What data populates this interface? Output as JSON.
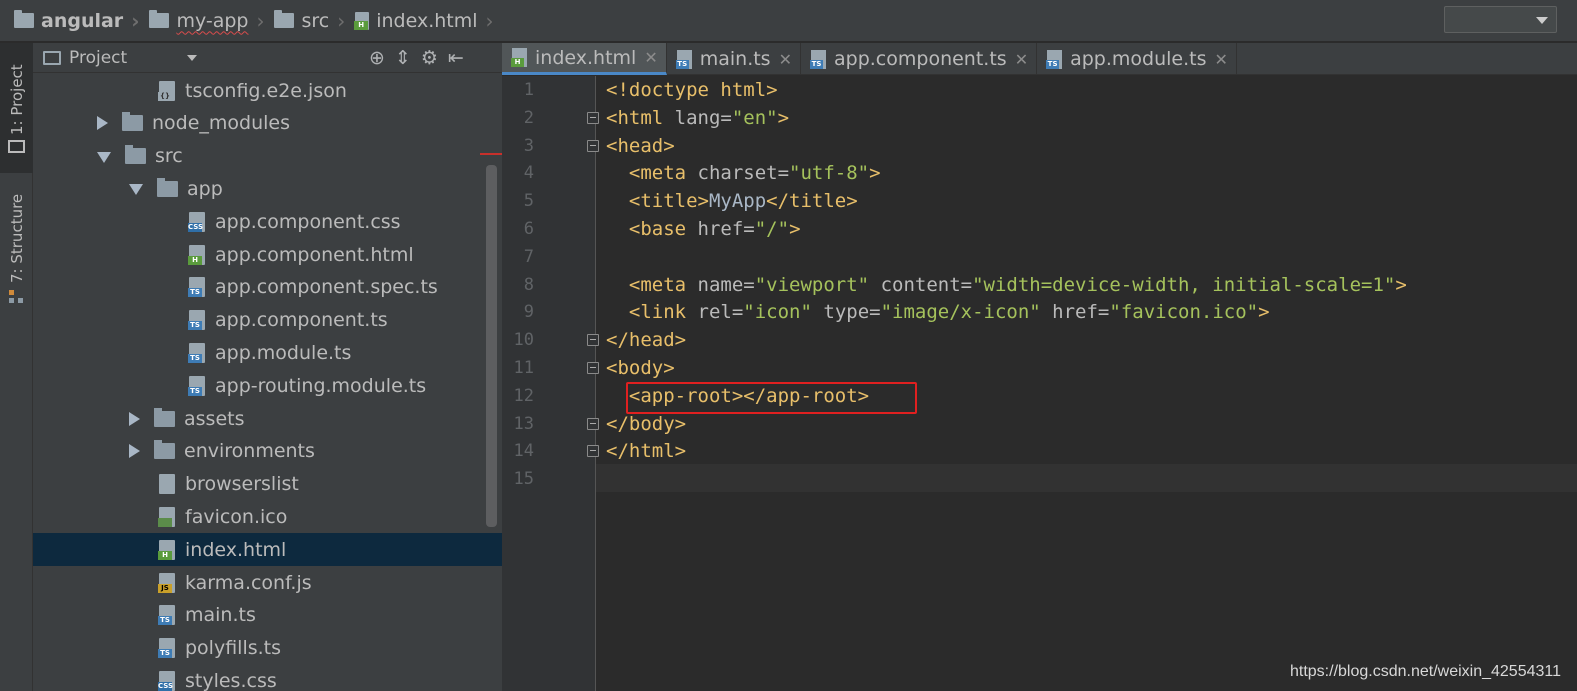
{
  "breadcrumb": [
    {
      "label": "angular",
      "bold": true
    },
    {
      "label": "my-app",
      "squiggle": true
    },
    {
      "label": "src"
    },
    {
      "label": "index.html",
      "file": true
    }
  ],
  "tool_stripe": {
    "project_label": "1: Project",
    "structure_label": "7: Structure"
  },
  "project_panel": {
    "title": "Project",
    "tools": [
      "⊕",
      "⇕",
      "⚙",
      "⇤"
    ],
    "tree": [
      {
        "name": "tsconfig.e2e.json",
        "kind": "file",
        "icon": "json",
        "depth": 2
      },
      {
        "name": "node_modules",
        "kind": "folder",
        "expanded": false,
        "depth": 1
      },
      {
        "name": "src",
        "kind": "folder",
        "expanded": true,
        "depth": 1
      },
      {
        "name": "app",
        "kind": "folder",
        "expanded": true,
        "depth": 2
      },
      {
        "name": "app.component.css",
        "kind": "file",
        "icon": "css",
        "depth": 3
      },
      {
        "name": "app.component.html",
        "kind": "file",
        "icon": "h",
        "depth": 3
      },
      {
        "name": "app.component.spec.ts",
        "kind": "file",
        "icon": "ts",
        "depth": 3
      },
      {
        "name": "app.component.ts",
        "kind": "file",
        "icon": "ts",
        "depth": 3
      },
      {
        "name": "app.module.ts",
        "kind": "file",
        "icon": "ts",
        "depth": 3
      },
      {
        "name": "app-routing.module.ts",
        "kind": "file",
        "icon": "ts",
        "depth": 3
      },
      {
        "name": "assets",
        "kind": "folder",
        "expanded": false,
        "depth": 2
      },
      {
        "name": "environments",
        "kind": "folder",
        "expanded": false,
        "depth": 2
      },
      {
        "name": "browserslist",
        "kind": "file",
        "icon": "txt",
        "depth": 2
      },
      {
        "name": "favicon.ico",
        "kind": "file",
        "icon": "img",
        "depth": 2
      },
      {
        "name": "index.html",
        "kind": "file",
        "icon": "h",
        "depth": 2,
        "selected": true
      },
      {
        "name": "karma.conf.js",
        "kind": "file",
        "icon": "js",
        "depth": 2
      },
      {
        "name": "main.ts",
        "kind": "file",
        "icon": "ts",
        "depth": 2
      },
      {
        "name": "polyfills.ts",
        "kind": "file",
        "icon": "ts",
        "depth": 2
      },
      {
        "name": "styles.css",
        "kind": "file",
        "icon": "css",
        "depth": 2
      }
    ]
  },
  "tabs": [
    {
      "label": "index.html",
      "icon": "h",
      "active": true
    },
    {
      "label": "main.ts",
      "icon": "ts"
    },
    {
      "label": "app.component.ts",
      "icon": "ts"
    },
    {
      "label": "app.module.ts",
      "icon": "ts"
    }
  ],
  "editor": {
    "lines": [
      [
        [
          "tg",
          "<!doctype html>"
        ]
      ],
      [
        [
          "tg",
          "<html "
        ],
        [
          "at",
          "lang="
        ],
        [
          "vl",
          "\"en\""
        ],
        [
          "tg",
          ">"
        ]
      ],
      [
        [
          "tg",
          "<head>"
        ]
      ],
      [
        [
          "tx",
          "  "
        ],
        [
          "tg",
          "<meta "
        ],
        [
          "at",
          "charset="
        ],
        [
          "vl",
          "\"utf-8\""
        ],
        [
          "tg",
          ">"
        ]
      ],
      [
        [
          "tx",
          "  "
        ],
        [
          "tg",
          "<title>"
        ],
        [
          "tx",
          "MyApp"
        ],
        [
          "tg",
          "</title>"
        ]
      ],
      [
        [
          "tx",
          "  "
        ],
        [
          "tg",
          "<base "
        ],
        [
          "at",
          "href="
        ],
        [
          "vl",
          "\"/\""
        ],
        [
          "tg",
          ">"
        ]
      ],
      [],
      [
        [
          "tx",
          "  "
        ],
        [
          "tg",
          "<meta "
        ],
        [
          "at",
          "name="
        ],
        [
          "vl",
          "\"viewport\""
        ],
        [
          "at",
          " content="
        ],
        [
          "vl",
          "\"width=device-width, initial-scale=1\""
        ],
        [
          "tg",
          ">"
        ]
      ],
      [
        [
          "tx",
          "  "
        ],
        [
          "tg",
          "<link "
        ],
        [
          "at",
          "rel="
        ],
        [
          "vl",
          "\"icon\""
        ],
        [
          "at",
          " type="
        ],
        [
          "vl",
          "\"image/x-icon\""
        ],
        [
          "at",
          " href="
        ],
        [
          "vl",
          "\"favicon.ico\""
        ],
        [
          "tg",
          ">"
        ]
      ],
      [
        [
          "tg",
          "</head>"
        ]
      ],
      [
        [
          "tg",
          "<body>"
        ]
      ],
      [
        [
          "tx",
          "  "
        ],
        [
          "tg",
          "<app-root></app-root>"
        ]
      ],
      [
        [
          "tg",
          "</body>"
        ]
      ],
      [
        [
          "tg",
          "</html>"
        ]
      ],
      []
    ],
    "fold_lines": [
      2,
      3,
      10,
      11,
      13,
      14
    ]
  },
  "watermark": "https://blog.csdn.net/weixin_42554311",
  "colors": {
    "tag": "#e8bf6a",
    "value": "#a5c25c",
    "selection": "#0d293e",
    "highlight_box": "#e02020"
  }
}
